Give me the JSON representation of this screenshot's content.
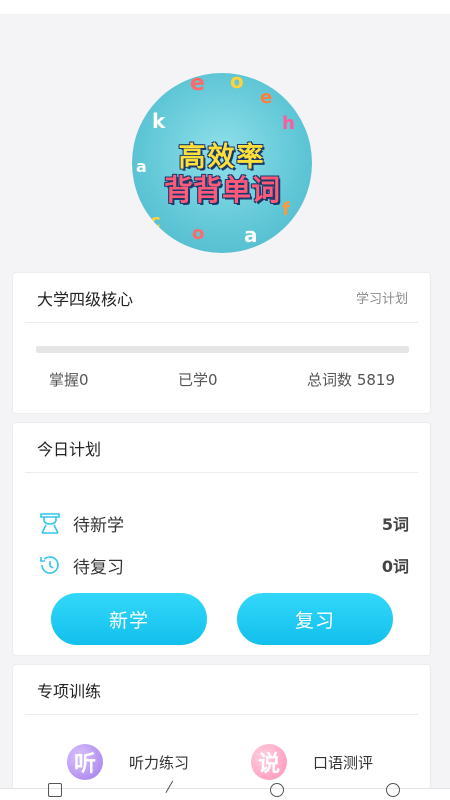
{
  "hero": {
    "line1": "高效率",
    "line2": "背背单词"
  },
  "course": {
    "title": "大学四级核心",
    "plan_link": "学习计划",
    "progress_fraction": 0,
    "mastered": "掌握0",
    "learned": "已学0",
    "total": "总词数 5819"
  },
  "today": {
    "title": "今日计划",
    "rows": [
      {
        "label": "待新学",
        "value": "5词",
        "icon": "new-word-icon"
      },
      {
        "label": "待复习",
        "value": "0词",
        "icon": "history-icon"
      }
    ],
    "new_button": "新学",
    "review_button": "复习"
  },
  "training": {
    "title": "专项训练",
    "items": [
      {
        "badge": "听",
        "label": "听力练习",
        "icon": "listening-icon"
      },
      {
        "badge": "说",
        "label": "口语测评",
        "icon": "speaking-icon"
      }
    ]
  },
  "colors": {
    "accent": "#1fc8f3",
    "listening_badge": "#b78ff0",
    "speaking_badge": "#ff9fbf"
  }
}
